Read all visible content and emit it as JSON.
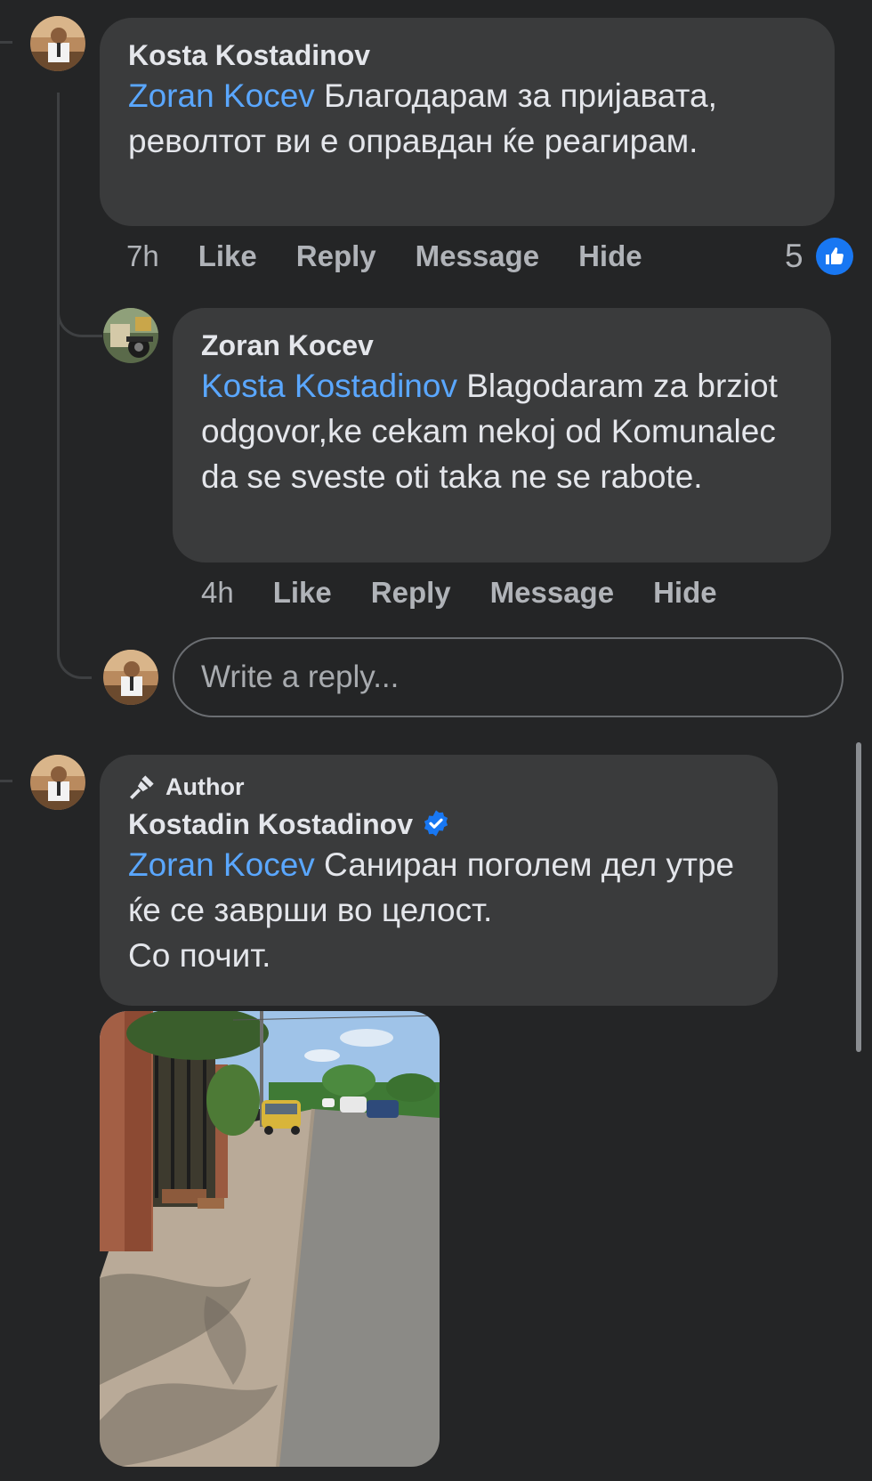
{
  "comments": [
    {
      "author": "Kosta Kostadinov",
      "mention": "Zoran Kocev",
      "text": " Благодарам за пријавата, револтот ви е оправдан ќе реагирам.",
      "time": "7h",
      "reaction_count": "5",
      "reaction_icon": "like-icon"
    },
    {
      "author": "Zoran Kocev",
      "mention": "Kosta Kostadinov",
      "text": " Blagodaram za brziot odgovor,ke cekam nekoj od Komunalec da se sveste oti taka ne se rabote.",
      "time": "4h"
    },
    {
      "badge": "Author",
      "badge_icon": "microphone-icon",
      "author": "Kostadin Kostadinov",
      "verified_icon": "verified-badge-icon",
      "mention": "Zoran Kocev",
      "text_lines": [
        " Саниран поголем дел утре ќе се заврши во целост.",
        "Со почит."
      ]
    }
  ],
  "actions": {
    "like": "Like",
    "reply": "Reply",
    "message": "Message",
    "hide": "Hide"
  },
  "reply_box": {
    "placeholder": "Write a reply..."
  },
  "colors": {
    "background": "#242526",
    "bubble": "#3a3b3c",
    "mention": "#5aa7ff",
    "meta_text": "#b0b3b8",
    "like_blue": "#1877f2"
  }
}
